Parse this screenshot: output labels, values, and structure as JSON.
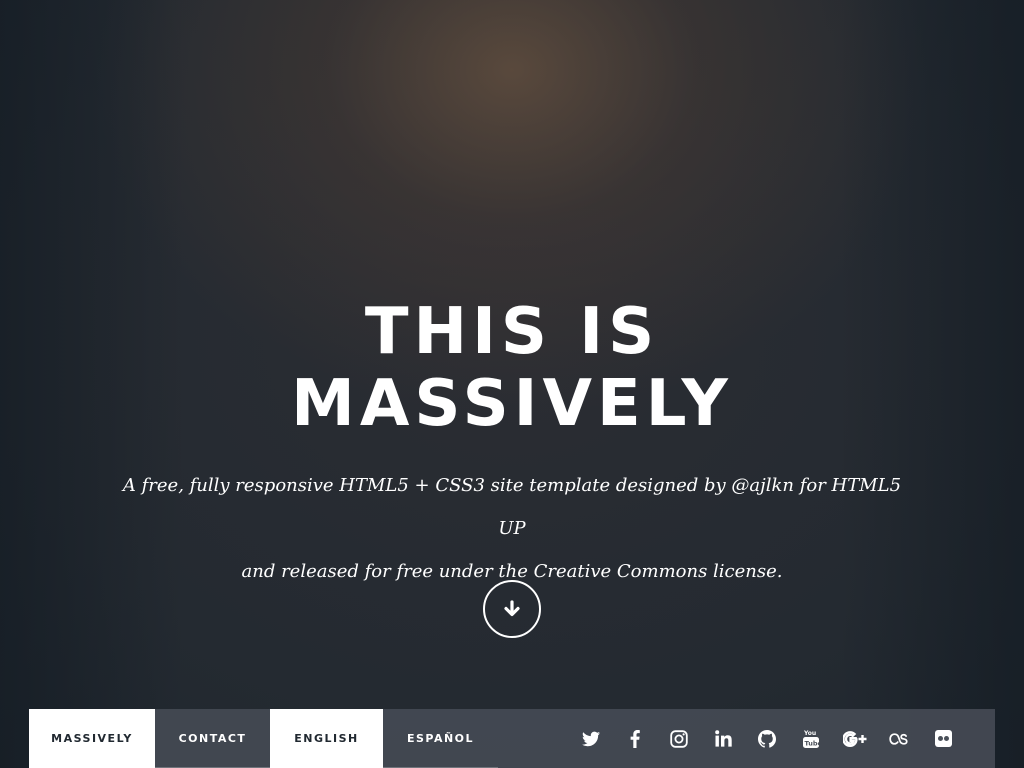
{
  "intro": {
    "title_line1": "THIS IS",
    "title_line2": "MASSIVELY",
    "subtitle_line1": "A free, fully responsive HTML5 + CSS3 site template designed by @ajlkn for HTML5 UP",
    "subtitle_line2": "and released for free under the Creative Commons license.",
    "scroll_icon": "arrow-down-icon"
  },
  "nav": {
    "links": [
      {
        "label": "Massively",
        "active": true
      },
      {
        "label": "Contact",
        "active": false
      },
      {
        "label": "English",
        "active": true
      },
      {
        "label": "Español",
        "active": false
      }
    ],
    "icons": [
      "twitter-icon",
      "facebook-icon",
      "instagram-icon",
      "linkedin-icon",
      "github-icon",
      "youtube-icon",
      "google-plus-icon",
      "lastfm-icon",
      "flickr-icon"
    ]
  },
  "colors": {
    "background": "#1e252d",
    "nav_background": "#444a54",
    "active_tab": "#ffffff",
    "active_tab_text": "#212931",
    "text": "#ffffff"
  }
}
